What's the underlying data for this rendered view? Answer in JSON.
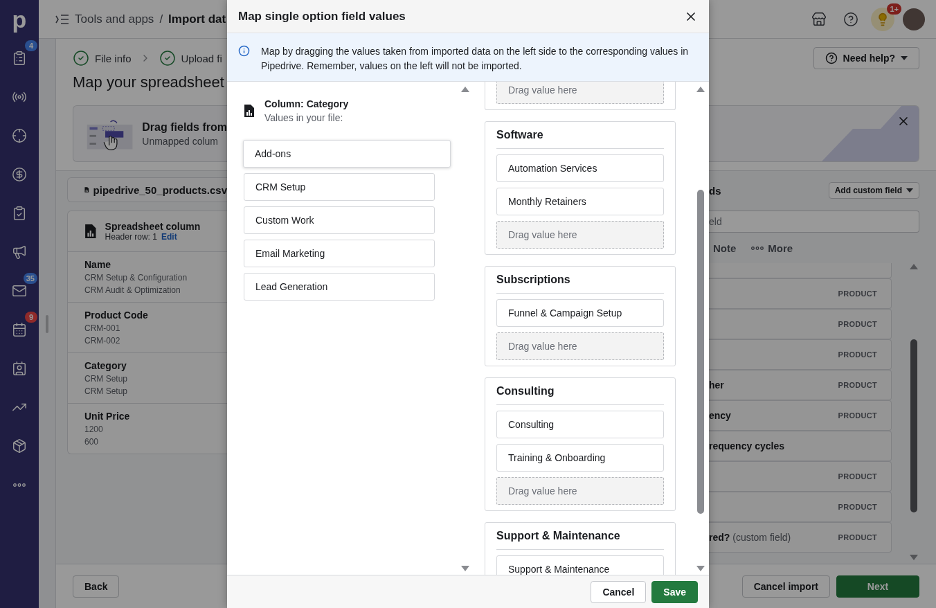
{
  "sidebar": {
    "logo": "p",
    "items": [
      {
        "kind": "badged",
        "badge": "4",
        "color": "#2a4f8f"
      },
      {
        "kind": "plain"
      },
      {
        "kind": "plain"
      },
      {
        "kind": "plain"
      },
      {
        "kind": "plain"
      },
      {
        "kind": "plain"
      },
      {
        "kind": "badged",
        "badge": "35",
        "color": "#2a4f8f"
      },
      {
        "kind": "badged",
        "badge": "9",
        "color": "#8f2a2a"
      },
      {
        "kind": "plain"
      },
      {
        "kind": "plain"
      },
      {
        "kind": "plain"
      },
      {
        "kind": "plain"
      }
    ]
  },
  "topbar": {
    "parent": "Tools and apps",
    "separator": "/",
    "current": "Import dat",
    "tips_badge": "1+"
  },
  "steps": [
    {
      "label": "File info",
      "done": true
    },
    {
      "label": "Upload fi",
      "done": true
    }
  ],
  "page_title": "Map your spreadsheet",
  "banner": {
    "title": "Drag fields from",
    "subtitle": "Unmapped colum"
  },
  "file_tab": "pipedrive_50_products.csv",
  "spreadsheet": {
    "title": "Spreadsheet column",
    "header_row": "Header row: 1",
    "edit": "Edit",
    "columns": [
      {
        "name": "Name",
        "values": [
          "CRM Setup & Configuration",
          "CRM Audit & Optimization"
        ]
      },
      {
        "name": "Product Code",
        "values": [
          "CRM-001",
          "CRM-002"
        ]
      },
      {
        "name": "Category",
        "values": [
          "CRM Setup",
          "CRM Setup"
        ]
      },
      {
        "name": "Unit Price",
        "values": [
          "1200",
          "600"
        ]
      }
    ]
  },
  "back_button": "Back",
  "help_button": "Need help?",
  "fields_panel": {
    "heading": "ds",
    "add_button": "Add custom field",
    "search_placeholder": "eld",
    "tabs": [
      "Note",
      "More"
    ],
    "rows": [
      {
        "kind": "blank"
      },
      {
        "tag": "PRODUCT"
      },
      {
        "tag": "PRODUCT"
      },
      {
        "tag": "PRODUCT"
      },
      {
        "text": "her",
        "tag": "PRODUCT"
      },
      {
        "text": "ency",
        "tag": "PRODUCT"
      },
      {
        "text": "requency cycles"
      },
      {
        "tag": "PRODUCT"
      },
      {
        "tag": "PRODUCT"
      },
      {
        "text": "red?",
        "note": "(custom field)",
        "tag": "PRODUCT"
      }
    ]
  },
  "cancel_import": "Cancel import",
  "next": "Next",
  "modal": {
    "title": "Map single option field values",
    "info": "Map by dragging the values taken from imported data on the left side to the corresponding values in Pipedrive. Remember, values on the left will not be imported.",
    "column_title": "Column: Category",
    "column_subtitle": "Values in your file:",
    "file_values": [
      {
        "label": "Add-ons",
        "dragging": true
      },
      {
        "label": "CRM Setup",
        "dragging": false
      },
      {
        "label": "Custom Work",
        "dragging": false
      },
      {
        "label": "Email Marketing",
        "dragging": false
      },
      {
        "label": "Lead Generation",
        "dragging": false
      }
    ],
    "groups": [
      {
        "slot": "Drag value here"
      },
      {
        "title": "Software",
        "values": [
          "Automation Services",
          "Monthly Retainers"
        ],
        "slot": "Drag value here"
      },
      {
        "title": "Subscriptions",
        "values": [
          "Funnel & Campaign Setup"
        ],
        "slot": "Drag value here"
      },
      {
        "title": "Consulting",
        "values": [
          "Consulting",
          "Training & Onboarding"
        ],
        "slot": "Drag value here"
      },
      {
        "title": "Support & Maintenance",
        "values": [
          "Support & Maintenance"
        ]
      }
    ],
    "cancel": "Cancel",
    "save": "Save"
  }
}
